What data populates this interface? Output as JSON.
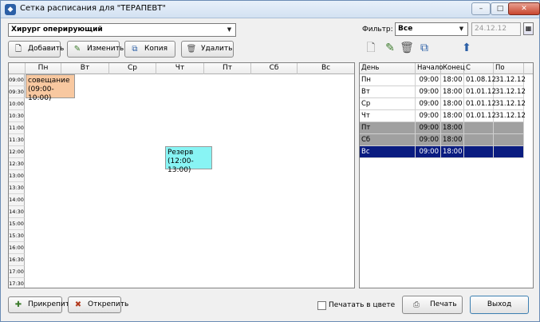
{
  "window": {
    "title": "Сетка расписания для \"ТЕРАПЕВТ\"",
    "minimize_glyph": "–",
    "maximize_glyph": "□",
    "close_glyph": "✕"
  },
  "doctor_select": {
    "value": "Хирург оперирующий"
  },
  "toolbar": {
    "add_label": "Добавить",
    "edit_label": "Изменить",
    "copy_label": "Копия",
    "delete_label": "Удалить"
  },
  "filter": {
    "label": "Фильтр:",
    "value": "Все",
    "date_value": "24.12.12"
  },
  "schedule": {
    "days": [
      "Пн",
      "Вт",
      "Ср",
      "Чт",
      "Пт",
      "Сб",
      "Вс"
    ],
    "times": [
      "09:00",
      "09:30",
      "10:00",
      "10:30",
      "11:00",
      "11:30",
      "12:00",
      "12:30",
      "13:00",
      "13:30",
      "14:00",
      "14:30",
      "15:00",
      "15:30",
      "16:00",
      "16:30",
      "17:00",
      "17:30"
    ],
    "events": [
      {
        "title": "совещание",
        "time": "(09:00-10:00)",
        "day": "Пн",
        "color": "#f8c8a0"
      },
      {
        "title": "Резерв",
        "time": "(12:00-13:00)",
        "day": "Чт",
        "color": "#88f4f4"
      }
    ]
  },
  "table": {
    "columns": [
      "День",
      "Начало",
      "Конец",
      "С",
      "По"
    ],
    "rows": [
      {
        "day": "Пн",
        "start": "09:00",
        "end": "18:00",
        "from": "01.08.12",
        "to": "31.12.12",
        "state": "normal"
      },
      {
        "day": "Вт",
        "start": "09:00",
        "end": "18:00",
        "from": "01.01.12",
        "to": "31.12.12",
        "state": "normal"
      },
      {
        "day": "Ср",
        "start": "09:00",
        "end": "18:00",
        "from": "01.01.12",
        "to": "31.12.12",
        "state": "normal"
      },
      {
        "day": "Чт",
        "start": "09:00",
        "end": "18:00",
        "from": "01.01.12",
        "to": "31.12.12",
        "state": "normal"
      },
      {
        "day": "Пт",
        "start": "09:00",
        "end": "18:00",
        "from": "",
        "to": "",
        "state": "disabled"
      },
      {
        "day": "Сб",
        "start": "09:00",
        "end": "18:00",
        "from": "",
        "to": "",
        "state": "disabled"
      },
      {
        "day": "Вс",
        "start": "09:00",
        "end": "18:00",
        "from": "",
        "to": "",
        "state": "selected"
      }
    ]
  },
  "bottom": {
    "attach_label": "Прикрепить",
    "detach_label": "Открепить",
    "color_print_label": "Печатать в цвете",
    "print_label": "Печать",
    "exit_label": "Выход"
  },
  "colors": {
    "selected_row": "#0a1c80",
    "disabled_row": "#a0a0a0",
    "accent": "#2b5fa6"
  }
}
